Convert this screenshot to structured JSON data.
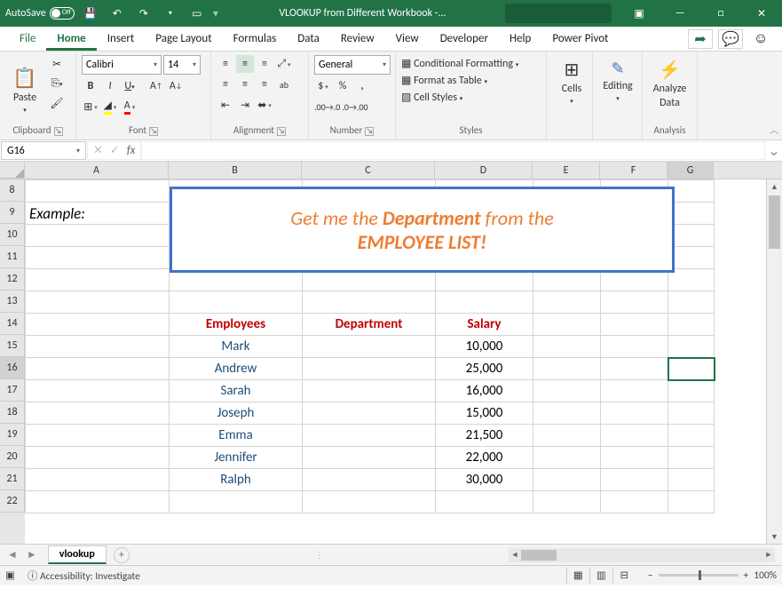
{
  "titlebar": {
    "autosave_label": "AutoSave",
    "autosave_state": "Off",
    "title": "VLOOKUP from Different Workbook  -...",
    "qat": {
      "save_icon": "save-icon",
      "undo_icon": "undo-icon",
      "redo_icon": "redo-icon"
    }
  },
  "tabs": {
    "file": "File",
    "home": "Home",
    "insert": "Insert",
    "page_layout": "Page Layout",
    "formulas": "Formulas",
    "data": "Data",
    "review": "Review",
    "view": "View",
    "developer": "Developer",
    "help": "Help",
    "power_pivot": "Power Pivot"
  },
  "ribbon": {
    "clipboard": {
      "paste": "Paste",
      "label": "Clipboard"
    },
    "font": {
      "name": "Calibri",
      "size": "14",
      "label": "Font"
    },
    "alignment": {
      "label": "Alignment"
    },
    "number": {
      "format": "General",
      "label": "Number"
    },
    "styles": {
      "cond": "Conditional Formatting",
      "table": "Format as Table",
      "cell": "Cell Styles",
      "label": "Styles"
    },
    "cells": {
      "btn": "Cells",
      "label": ""
    },
    "editing": {
      "btn": "Editing",
      "label": ""
    },
    "analysis": {
      "btn1": "Analyze",
      "btn2": "Data",
      "label": "Analysis"
    }
  },
  "formula_bar": {
    "namebox": "G16",
    "formula": ""
  },
  "columns": [
    "A",
    "B",
    "C",
    "D",
    "E",
    "F",
    "G"
  ],
  "rows": [
    "8",
    "9",
    "10",
    "11",
    "12",
    "13",
    "14",
    "15",
    "16",
    "17",
    "18",
    "19",
    "20",
    "21",
    "22"
  ],
  "content": {
    "example_label": "Example:",
    "callout_pre": "Get me the ",
    "callout_b1": "Department",
    "callout_mid": " from the",
    "callout_b2": "EMPLOYEE LIST!",
    "headers": {
      "emp": "Employees",
      "dept": "Department",
      "sal": "Salary"
    },
    "table": [
      {
        "emp": "Mark",
        "dept": "",
        "sal": "10,000"
      },
      {
        "emp": "Andrew",
        "dept": "",
        "sal": "25,000"
      },
      {
        "emp": "Sarah",
        "dept": "",
        "sal": "16,000"
      },
      {
        "emp": "Joseph",
        "dept": "",
        "sal": "15,000"
      },
      {
        "emp": "Emma",
        "dept": "",
        "sal": "21,500"
      },
      {
        "emp": "Jennifer",
        "dept": "",
        "sal": "22,000"
      },
      {
        "emp": "Ralph",
        "dept": "",
        "sal": "30,000"
      }
    ]
  },
  "sheet_tabs": {
    "active": "vlookup"
  },
  "statusbar": {
    "ready": "",
    "access": "Accessibility: Investigate",
    "zoom": "100%"
  }
}
